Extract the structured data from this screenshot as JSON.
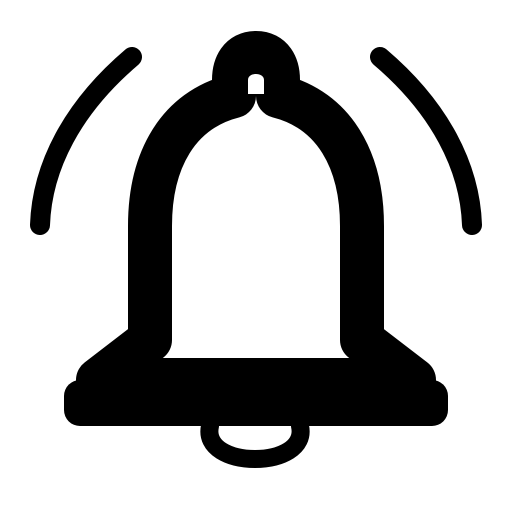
{
  "icon": {
    "name": "bell-ringing-icon",
    "stroke_color": "#000000",
    "fill_color": "#ffffff",
    "background": "#ffffff"
  }
}
